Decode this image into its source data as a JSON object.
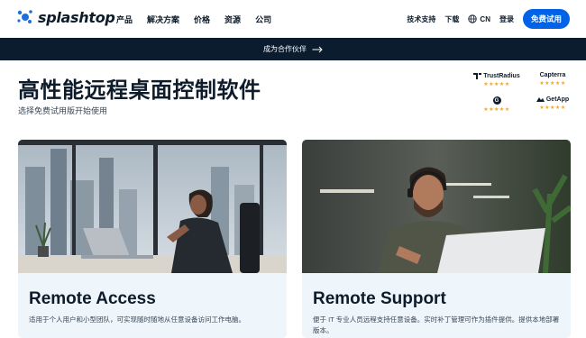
{
  "nav": {
    "logo_text": "splashtop",
    "items": [
      "产品",
      "解决方案",
      "价格",
      "资源",
      "公司"
    ],
    "right": {
      "support": "技术支持",
      "download": "下载",
      "lang": "CN",
      "login": "登录",
      "cta": "免费试用"
    }
  },
  "banner": {
    "text": "成为合作伙伴"
  },
  "hero": {
    "title": "高性能远程桌面控制软件",
    "subtitle": "选择免费试用版开始使用"
  },
  "ratings": [
    {
      "name": "TrustRadius",
      "stars": "★★★★★"
    },
    {
      "name": "Capterra",
      "stars": "★★★★★"
    },
    {
      "name": "G",
      "stars": "★★★★★"
    },
    {
      "name": "GetApp",
      "stars": "★★★★★"
    }
  ],
  "cards": [
    {
      "title": "Remote Access",
      "desc": "适用于个人用户和小型团队，可实现随时随地从任意设备访问工作电脑。"
    },
    {
      "title": "Remote Support",
      "desc": "便于 IT 专业人员远程支持任意设备。实时补丁管理可作为插件提供。提供本地部署版本。"
    }
  ],
  "colors": {
    "accent": "#0062e6",
    "banner_bg": "#0b1c2f",
    "star": "#f5a623"
  }
}
